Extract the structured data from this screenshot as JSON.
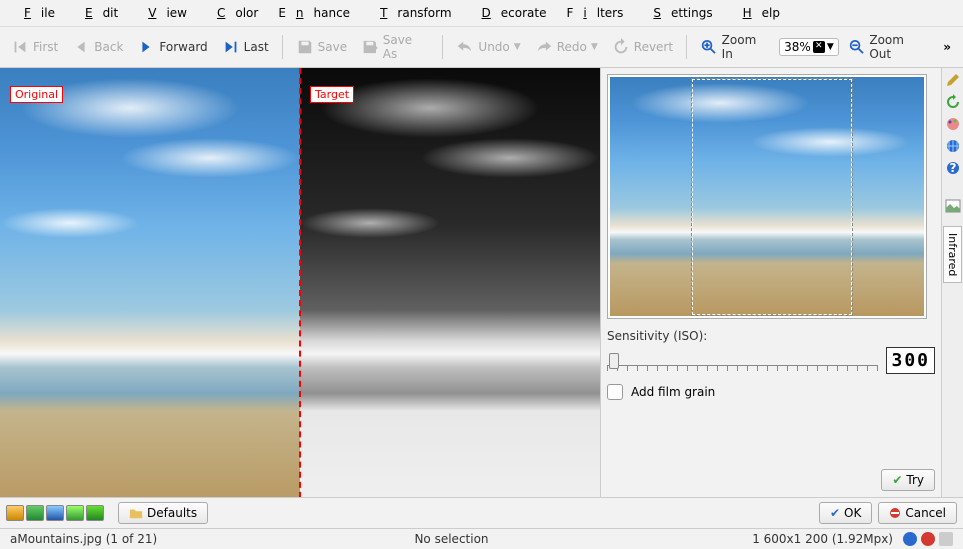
{
  "menu": [
    "File",
    "Edit",
    "View",
    "Color",
    "Enhance",
    "Transform",
    "Decorate",
    "Filters",
    "Settings",
    "Help"
  ],
  "toolbar": {
    "first": "First",
    "back": "Back",
    "forward": "Forward",
    "last": "Last",
    "save": "Save",
    "save_as": "Save As",
    "undo": "Undo",
    "redo": "Redo",
    "revert": "Revert",
    "zoom_in": "Zoom In",
    "zoom_value": "38%",
    "zoom_out": "Zoom Out"
  },
  "canvas": {
    "original_label": "Original",
    "target_label": "Target"
  },
  "panel": {
    "sensitivity_label": "Sensitivity (ISO):",
    "sensitivity_value": "300",
    "film_grain_label": "Add film grain",
    "film_grain_checked": false,
    "vtab": "Infrared",
    "try": "Try"
  },
  "bottom": {
    "defaults": "Defaults",
    "ok": "OK",
    "cancel": "Cancel"
  },
  "status": {
    "file": "aMountains.jpg (1 of 21)",
    "selection": "No selection",
    "dims": "1 600x1 200 (1.92Mpx)"
  },
  "colors": {
    "accent_blue": "#1e62c8",
    "accent_green": "#3aa53a",
    "accent_red": "#d43a2f"
  }
}
